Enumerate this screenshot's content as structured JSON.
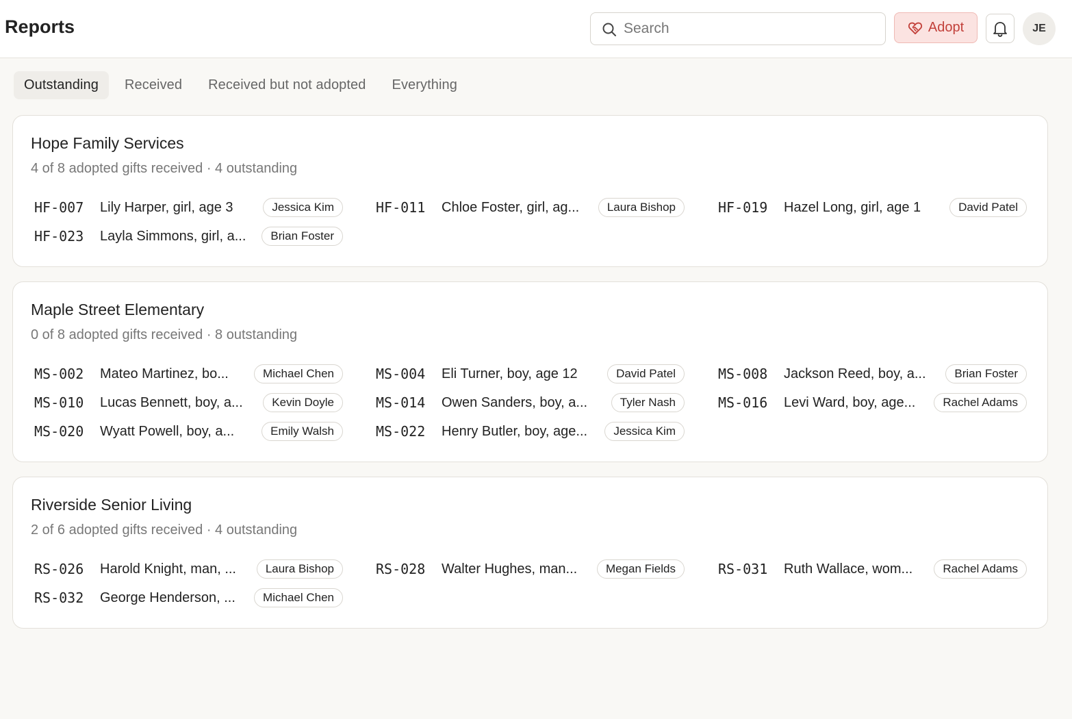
{
  "header": {
    "title": "Reports",
    "search_placeholder": "Search",
    "adopt_label": "Adopt",
    "user_initials": "JE"
  },
  "tabs": [
    {
      "label": "Outstanding",
      "active": true
    },
    {
      "label": "Received",
      "active": false
    },
    {
      "label": "Received but not adopted",
      "active": false
    },
    {
      "label": "Everything",
      "active": false
    }
  ],
  "colors": {
    "accent": "#c2403a",
    "accent_bg": "#fbe3e1",
    "page_bg": "#f9f8f5"
  },
  "groups": [
    {
      "name": "Hope Family Services",
      "summary": "4 of 8 adopted gifts received · 4 outstanding",
      "items": [
        {
          "code": "HF-007",
          "name": "Lily Harper, girl, age 3",
          "adopter": "Jessica Kim"
        },
        {
          "code": "HF-011",
          "name": "Chloe Foster, girl, ag...",
          "adopter": "Laura Bishop"
        },
        {
          "code": "HF-019",
          "name": "Hazel Long, girl, age 1",
          "adopter": "David Patel"
        },
        {
          "code": "HF-023",
          "name": "Layla Simmons, girl, a...",
          "adopter": "Brian Foster"
        }
      ]
    },
    {
      "name": "Maple Street Elementary",
      "summary": "0 of 8 adopted gifts received · 8 outstanding",
      "items": [
        {
          "code": "MS-002",
          "name": "Mateo Martinez, bo...",
          "adopter": "Michael Chen"
        },
        {
          "code": "MS-004",
          "name": "Eli Turner, boy, age 12",
          "adopter": "David Patel"
        },
        {
          "code": "MS-008",
          "name": "Jackson Reed, boy, a...",
          "adopter": "Brian Foster"
        },
        {
          "code": "MS-010",
          "name": "Lucas Bennett, boy, a...",
          "adopter": "Kevin Doyle"
        },
        {
          "code": "MS-014",
          "name": "Owen Sanders, boy, a...",
          "adopter": "Tyler Nash"
        },
        {
          "code": "MS-016",
          "name": "Levi Ward, boy, age...",
          "adopter": "Rachel Adams"
        },
        {
          "code": "MS-020",
          "name": "Wyatt Powell, boy, a...",
          "adopter": "Emily Walsh"
        },
        {
          "code": "MS-022",
          "name": "Henry Butler, boy, age...",
          "adopter": "Jessica Kim"
        }
      ]
    },
    {
      "name": "Riverside Senior Living",
      "summary": "2 of 6 adopted gifts received · 4 outstanding",
      "items": [
        {
          "code": "RS-026",
          "name": "Harold Knight, man, ...",
          "adopter": "Laura Bishop"
        },
        {
          "code": "RS-028",
          "name": "Walter Hughes, man...",
          "adopter": "Megan Fields"
        },
        {
          "code": "RS-031",
          "name": "Ruth Wallace, wom...",
          "adopter": "Rachel Adams"
        },
        {
          "code": "RS-032",
          "name": "George Henderson, ...",
          "adopter": "Michael Chen"
        }
      ]
    }
  ]
}
